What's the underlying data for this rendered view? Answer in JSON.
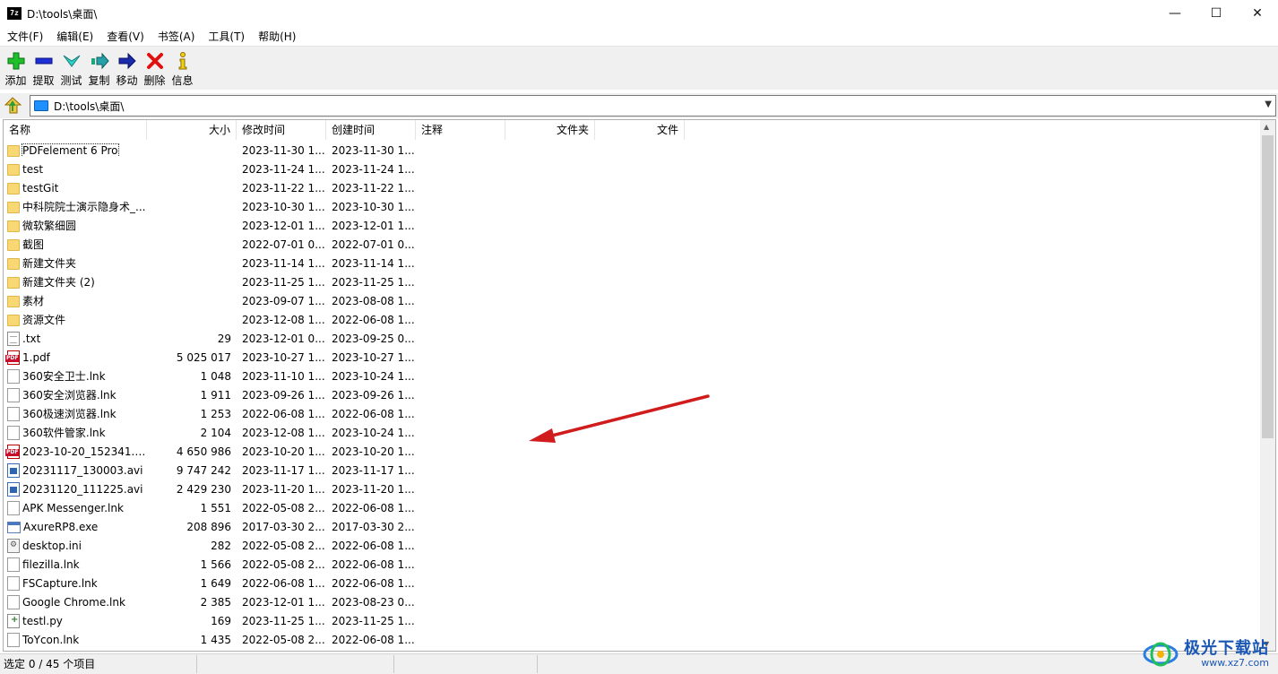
{
  "window": {
    "app_icon_text": "7z",
    "title": "D:\\tools\\桌面\\",
    "controls": {
      "minimize": "—",
      "maximize": "☐",
      "close": "✕"
    }
  },
  "menu": [
    {
      "label": "文件(F)"
    },
    {
      "label": "编辑(E)"
    },
    {
      "label": "查看(V)"
    },
    {
      "label": "书签(A)"
    },
    {
      "label": "工具(T)"
    },
    {
      "label": "帮助(H)"
    }
  ],
  "toolbar": [
    {
      "label": "添加",
      "icon": "add-icon"
    },
    {
      "label": "提取",
      "icon": "extract-icon"
    },
    {
      "label": "测试",
      "icon": "test-icon"
    },
    {
      "label": "复制",
      "icon": "copy-icon"
    },
    {
      "label": "移动",
      "icon": "move-icon"
    },
    {
      "label": "删除",
      "icon": "delete-icon"
    },
    {
      "label": "信息",
      "icon": "info-icon"
    }
  ],
  "address": {
    "path": "D:\\tools\\桌面\\"
  },
  "columns": [
    {
      "label": "名称"
    },
    {
      "label": "大小"
    },
    {
      "label": "修改时间"
    },
    {
      "label": "创建时间"
    },
    {
      "label": "注释"
    },
    {
      "label": "文件夹"
    },
    {
      "label": "文件"
    }
  ],
  "files": [
    {
      "name": "PDFelement 6 Pro",
      "size": "",
      "modified": "2023-11-30 1...",
      "created": "2023-11-30 1...",
      "type": "folder"
    },
    {
      "name": "test",
      "size": "",
      "modified": "2023-11-24 1...",
      "created": "2023-11-24 1...",
      "type": "folder"
    },
    {
      "name": "testGit",
      "size": "",
      "modified": "2023-11-22 1...",
      "created": "2023-11-22 1...",
      "type": "folder"
    },
    {
      "name": "中科院院士演示隐身术_...",
      "size": "",
      "modified": "2023-10-30 1...",
      "created": "2023-10-30 1...",
      "type": "folder"
    },
    {
      "name": "微软繁细圆",
      "size": "",
      "modified": "2023-12-01 1...",
      "created": "2023-12-01 1...",
      "type": "folder"
    },
    {
      "name": "截图",
      "size": "",
      "modified": "2022-07-01 0...",
      "created": "2022-07-01 0...",
      "type": "folder"
    },
    {
      "name": "新建文件夹",
      "size": "",
      "modified": "2023-11-14 1...",
      "created": "2023-11-14 1...",
      "type": "folder"
    },
    {
      "name": "新建文件夹 (2)",
      "size": "",
      "modified": "2023-11-25 1...",
      "created": "2023-11-25 1...",
      "type": "folder"
    },
    {
      "name": "素材",
      "size": "",
      "modified": "2023-09-07 1...",
      "created": "2023-08-08 1...",
      "type": "folder"
    },
    {
      "name": "资源文件",
      "size": "",
      "modified": "2023-12-08 1...",
      "created": "2022-06-08 1...",
      "type": "folder"
    },
    {
      "name": ".txt",
      "size": "29",
      "modified": "2023-12-01 0...",
      "created": "2023-09-25 0...",
      "type": "txt"
    },
    {
      "name": "1.pdf",
      "size": "5 025 017",
      "modified": "2023-10-27 1...",
      "created": "2023-10-27 1...",
      "type": "pdf"
    },
    {
      "name": "360安全卫士.lnk",
      "size": "1 048",
      "modified": "2023-11-10 1...",
      "created": "2023-10-24 1...",
      "type": "file"
    },
    {
      "name": "360安全浏览器.lnk",
      "size": "1 911",
      "modified": "2023-09-26 1...",
      "created": "2023-09-26 1...",
      "type": "file"
    },
    {
      "name": "360极速浏览器.lnk",
      "size": "1 253",
      "modified": "2022-06-08 1...",
      "created": "2022-06-08 1...",
      "type": "file"
    },
    {
      "name": "360软件管家.lnk",
      "size": "2 104",
      "modified": "2023-12-08 1...",
      "created": "2023-10-24 1...",
      "type": "file"
    },
    {
      "name": "2023-10-20_152341.pdf",
      "size": "4 650 986",
      "modified": "2023-10-20 1...",
      "created": "2023-10-20 1...",
      "type": "pdf"
    },
    {
      "name": "20231117_130003.avi",
      "size": "9 747 242",
      "modified": "2023-11-17 1...",
      "created": "2023-11-17 1...",
      "type": "avi"
    },
    {
      "name": "20231120_111225.avi",
      "size": "2 429 230",
      "modified": "2023-11-20 1...",
      "created": "2023-11-20 1...",
      "type": "avi"
    },
    {
      "name": "APK Messenger.lnk",
      "size": "1 551",
      "modified": "2022-05-08 2...",
      "created": "2022-06-08 1...",
      "type": "file"
    },
    {
      "name": "AxureRP8.exe",
      "size": "208 896",
      "modified": "2017-03-30 2...",
      "created": "2017-03-30 2...",
      "type": "exe"
    },
    {
      "name": "desktop.ini",
      "size": "282",
      "modified": "2022-05-08 2...",
      "created": "2022-06-08 1...",
      "type": "ini"
    },
    {
      "name": "filezilla.lnk",
      "size": "1 566",
      "modified": "2022-05-08 2...",
      "created": "2022-06-08 1...",
      "type": "file"
    },
    {
      "name": "FSCapture.lnk",
      "size": "1 649",
      "modified": "2022-06-08 1...",
      "created": "2022-06-08 1...",
      "type": "file"
    },
    {
      "name": "Google Chrome.lnk",
      "size": "2 385",
      "modified": "2023-12-01 1...",
      "created": "2023-08-23 0...",
      "type": "file"
    },
    {
      "name": "testl.py",
      "size": "169",
      "modified": "2023-11-25 1...",
      "created": "2023-11-25 1...",
      "type": "py"
    },
    {
      "name": "ToYcon.lnk",
      "size": "1 435",
      "modified": "2022-05-08 2...",
      "created": "2022-06-08 1...",
      "type": "file"
    }
  ],
  "status": {
    "selected": "选定 0 / 45 个项目",
    "segment2": "",
    "segment3": ""
  },
  "watermark": {
    "title": "极光下载站",
    "url": "www.xz7.com"
  },
  "colors": {
    "arrow": "#d01c1c",
    "folder": "#f8d775",
    "accent": "#1a57b5"
  }
}
